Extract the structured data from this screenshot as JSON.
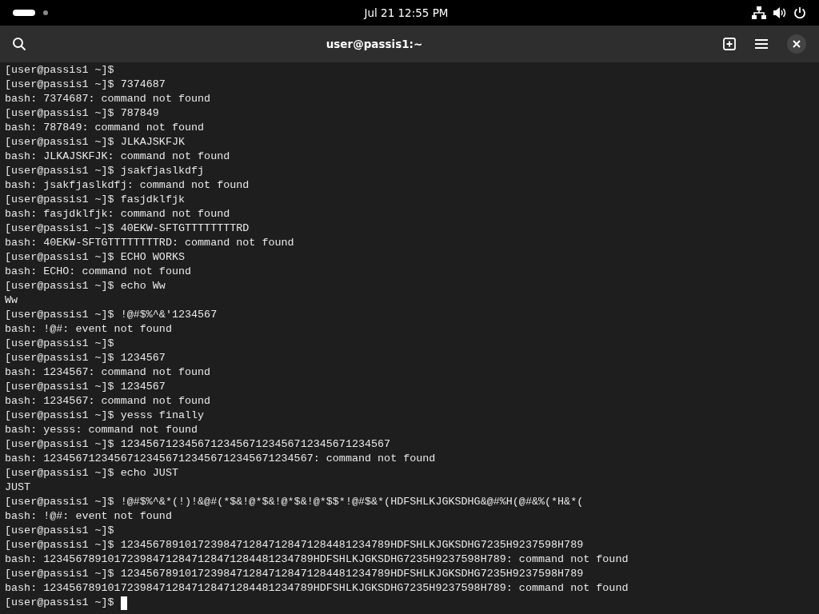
{
  "top_bar": {
    "clock": "Jul 21  12:55 PM"
  },
  "window": {
    "title": "user@passis1:~"
  },
  "terminal": {
    "lines": [
      "[user@passis1 ~]$",
      "[user@passis1 ~]$ 7374687",
      "bash: 7374687: command not found",
      "[user@passis1 ~]$ 787849",
      "bash: 787849: command not found",
      "[user@passis1 ~]$ JLKAJSKFJK",
      "bash: JLKAJSKFJK: command not found",
      "[user@passis1 ~]$ jsakfjaslkdfj",
      "bash: jsakfjaslkdfj: command not found",
      "[user@passis1 ~]$ fasjdklfjk",
      "bash: fasjdklfjk: command not found",
      "[user@passis1 ~]$ 40EKW-SFTGTTTTTTTTRD",
      "bash: 40EKW-SFTGTTTTTTTTRD: command not found",
      "[user@passis1 ~]$ ECHO WORKS",
      "bash: ECHO: command not found",
      "[user@passis1 ~]$ echo Ww",
      "Ww",
      "[user@passis1 ~]$ !@#$%^&'1234567",
      "bash: !@#: event not found",
      "[user@passis1 ~]$",
      "[user@passis1 ~]$ 1234567",
      "bash: 1234567: command not found",
      "[user@passis1 ~]$ 1234567",
      "bash: 1234567: command not found",
      "[user@passis1 ~]$ yesss finally",
      "bash: yesss: command not found",
      "[user@passis1 ~]$ 123456712345671234567123456712345671234567",
      "bash: 123456712345671234567123456712345671234567: command not found",
      "[user@passis1 ~]$ echo JUST",
      "JUST",
      "[user@passis1 ~]$ !@#$%^&*(!)!&@#(*$&!@*$&!@*$&!@*$$*!@#$&*(HDFSHLKJGKSDHG&@#%H(@#&%(*H&*(",
      "bash: !@#: event not found",
      "[user@passis1 ~]$",
      "[user@passis1 ~]$ 123456789101723984712847128471284481234789HDFSHLKJGKSDHG7235H9237598H789",
      "bash: 123456789101723984712847128471284481234789HDFSHLKJGKSDHG7235H9237598H789: command not found",
      "[user@passis1 ~]$ 123456789101723984712847128471284481234789HDFSHLKJGKSDHG7235H9237598H789",
      "bash: 123456789101723984712847128471284481234789HDFSHLKJGKSDHG7235H9237598H789: command not found",
      "[user@passis1 ~]$"
    ],
    "cursor_visible": true
  }
}
